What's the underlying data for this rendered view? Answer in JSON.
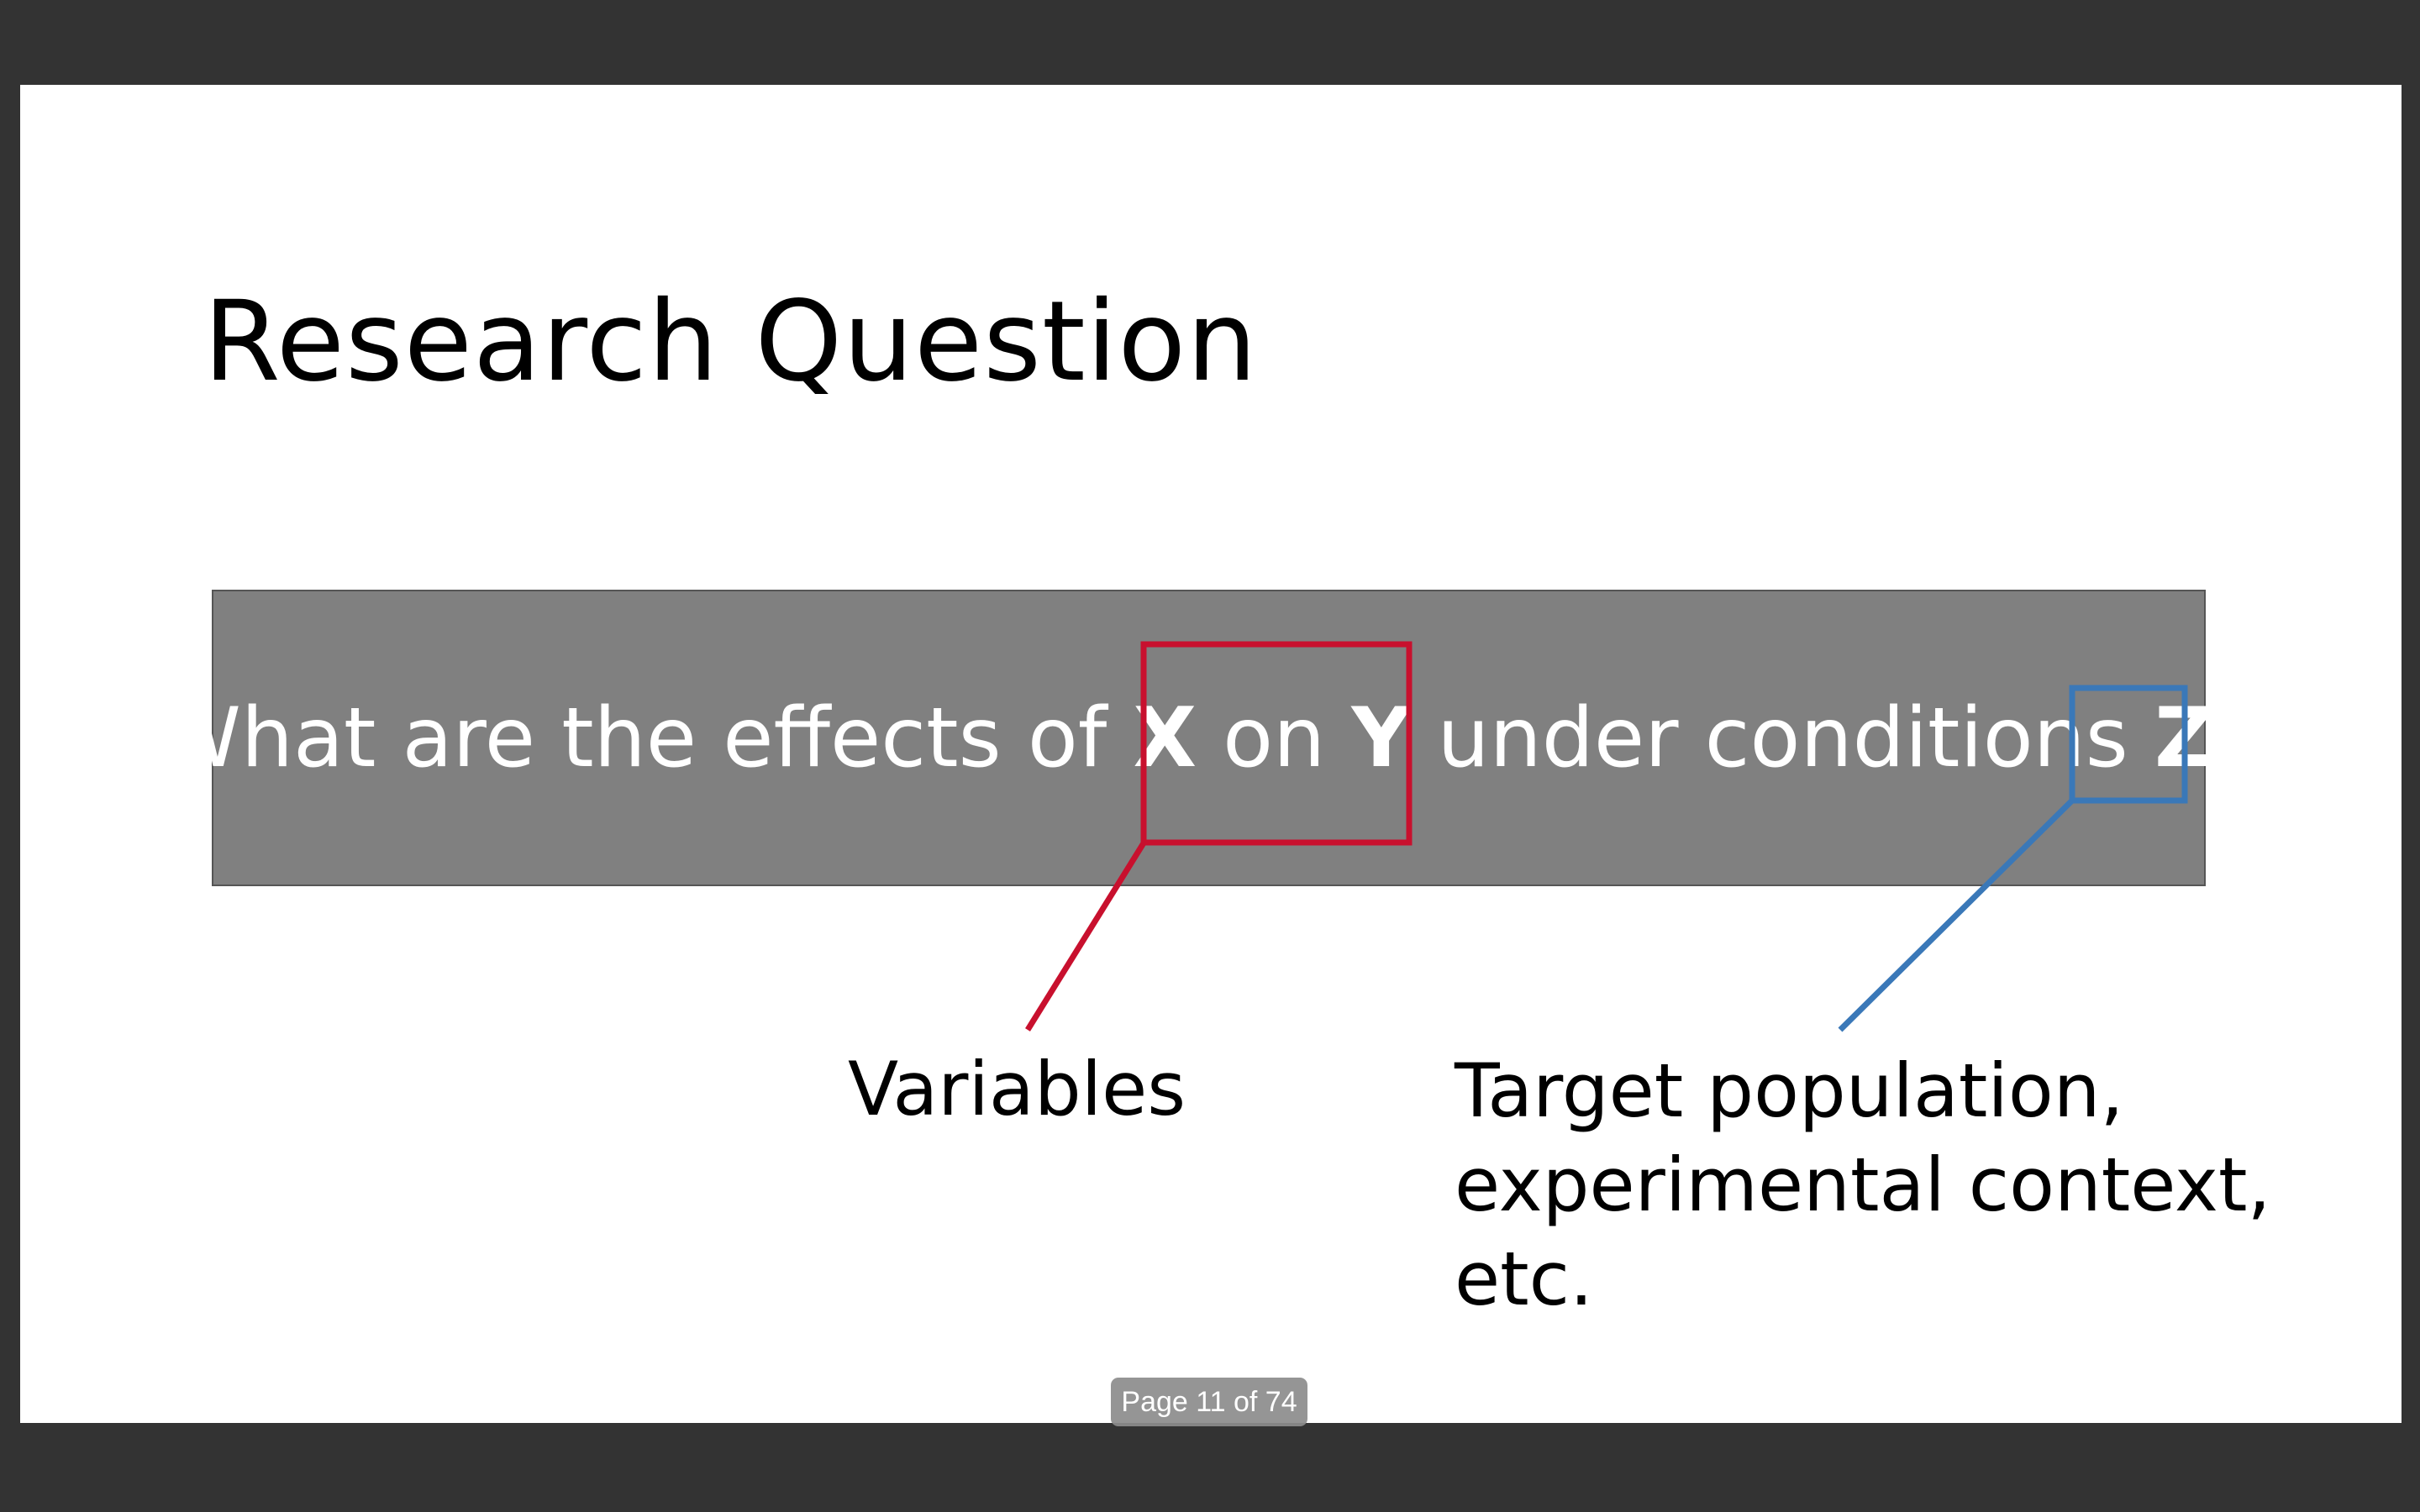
{
  "slide": {
    "title": "Research Question",
    "question": {
      "part1": "What are the effects of ",
      "var_x": "X",
      "mid": " on ",
      "var_y": "Y",
      "part2": " under conditions ",
      "var_z": "Z",
      "end": "?"
    },
    "callouts": [
      {
        "label": "Variables",
        "color": "#c8102e"
      },
      {
        "label": "Target population, experimental context, etc.",
        "color": "#3a78b8"
      }
    ]
  },
  "viewer": {
    "page_indicator": "Page 11 of 74",
    "background": "#333333"
  }
}
